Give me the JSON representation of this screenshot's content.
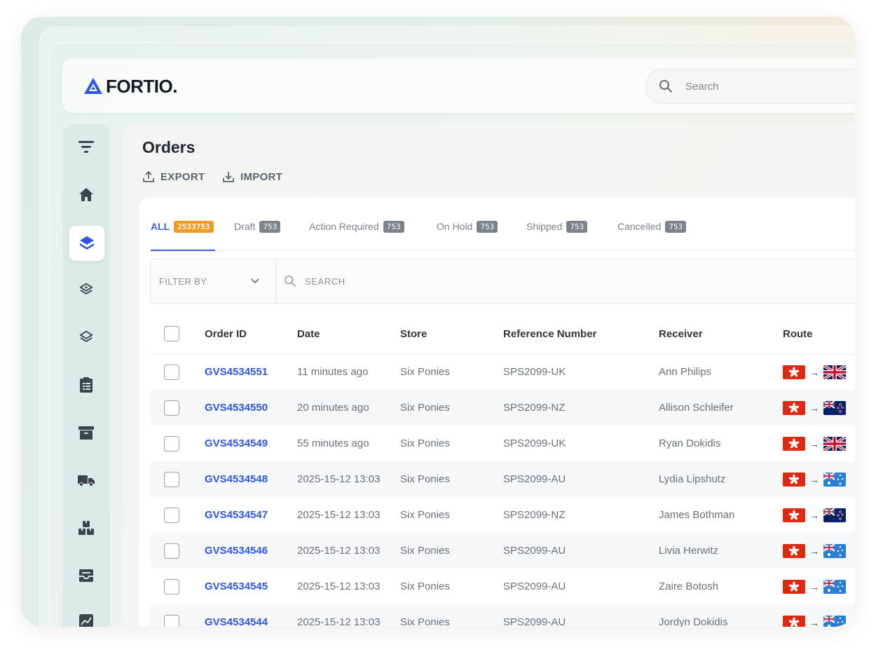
{
  "app": {
    "brand": "FORTIO."
  },
  "topbar": {
    "search_placeholder": "Search"
  },
  "page": {
    "title": "Orders",
    "export_label": "EXPORT",
    "import_label": "IMPORT"
  },
  "sidebar": {
    "items": [
      {
        "name": "filter-icon",
        "active": false
      },
      {
        "name": "home-icon",
        "active": false
      },
      {
        "name": "layers-icon",
        "active": true
      },
      {
        "name": "layers-outline-icon",
        "active": false
      },
      {
        "name": "layers-stack-icon",
        "active": false
      },
      {
        "name": "clipboard-icon",
        "active": false
      },
      {
        "name": "archive-icon",
        "active": false
      },
      {
        "name": "truck-icon",
        "active": false
      },
      {
        "name": "boxes-icon",
        "active": false
      },
      {
        "name": "inbox-icon",
        "active": false
      },
      {
        "name": "chart-icon",
        "active": false
      }
    ]
  },
  "tabs": [
    {
      "label": "ALL",
      "count": "2533753"
    },
    {
      "label": "Draft",
      "count": "753"
    },
    {
      "label": "Action Required",
      "count": "753"
    },
    {
      "label": "On Hold",
      "count": "753"
    },
    {
      "label": "Shipped",
      "count": "753"
    },
    {
      "label": "Cancelled",
      "count": "753"
    }
  ],
  "filter": {
    "label": "FILTER BY",
    "search_placeholder": "SEARCH"
  },
  "table": {
    "columns": [
      "Order ID",
      "Date",
      "Store",
      "Reference Number",
      "Receiver",
      "Route"
    ],
    "rows": [
      {
        "id": "GVS4534551",
        "date": "11 minutes ago",
        "store": "Six Ponies",
        "ref": "SPS2099-UK",
        "receiver": "Ann Philips",
        "from": "HK",
        "to": "UK"
      },
      {
        "id": "GVS4534550",
        "date": "20 minutes ago",
        "store": "Six Ponies",
        "ref": "SPS2099-NZ",
        "receiver": "Allison Schleifer",
        "from": "HK",
        "to": "NZ"
      },
      {
        "id": "GVS4534549",
        "date": "55 minutes ago",
        "store": "Six Ponies",
        "ref": "SPS2099-UK",
        "receiver": "Ryan Dokidis",
        "from": "HK",
        "to": "UK"
      },
      {
        "id": "GVS4534548",
        "date": "2025-15-12 13:03",
        "store": "Six Ponies",
        "ref": "SPS2099-AU",
        "receiver": "Lydia Lipshutz",
        "from": "HK",
        "to": "AU"
      },
      {
        "id": "GVS4534547",
        "date": "2025-15-12 13:03",
        "store": "Six Ponies",
        "ref": "SPS2099-NZ",
        "receiver": "James Bothman",
        "from": "HK",
        "to": "NZ"
      },
      {
        "id": "GVS4534546",
        "date": "2025-15-12 13:03",
        "store": "Six Ponies",
        "ref": "SPS2099-AU",
        "receiver": "Livia Herwitz",
        "from": "HK",
        "to": "AU"
      },
      {
        "id": "GVS4534545",
        "date": "2025-15-12 13:03",
        "store": "Six Ponies",
        "ref": "SPS2099-AU",
        "receiver": "Zaire Botosh",
        "from": "HK",
        "to": "AU"
      },
      {
        "id": "GVS4534544",
        "date": "2025-15-12 13:03",
        "store": "Six Ponies",
        "ref": "SPS2099-AU",
        "receiver": "Jordyn Dokidis",
        "from": "HK",
        "to": "AU"
      }
    ]
  },
  "colors": {
    "accent": "#3b5bdb",
    "link": "#2f56e0",
    "badge_active": "#f39a1e",
    "badge": "#7b828a"
  }
}
